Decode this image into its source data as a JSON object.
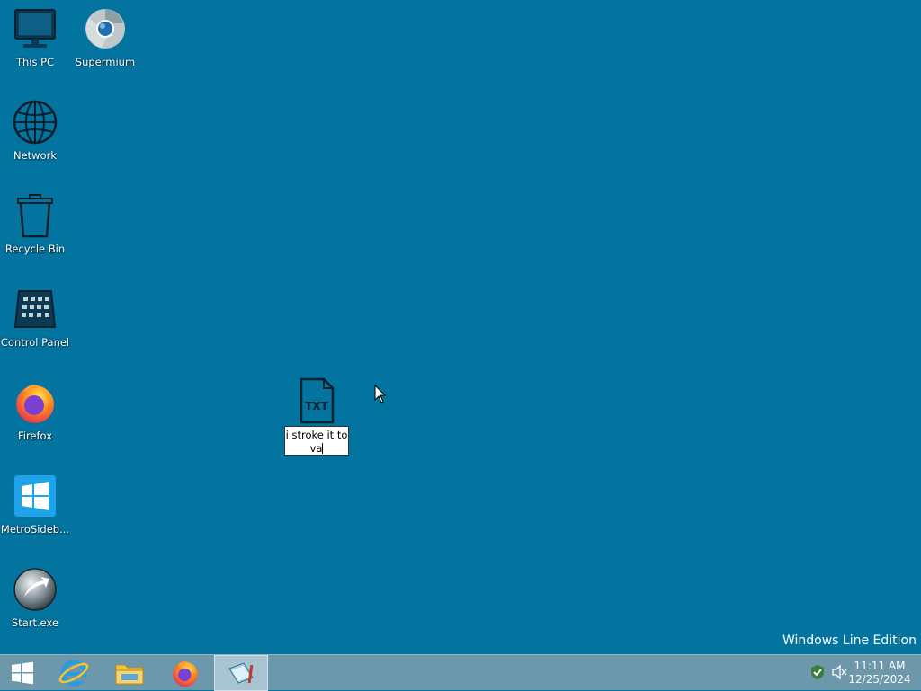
{
  "desktop": {
    "background_color": "#03739f",
    "icons": [
      {
        "label": "This PC",
        "icon": "monitor-icon"
      },
      {
        "label": "Supermium",
        "icon": "supermium-browser-icon"
      },
      {
        "label": "Network",
        "icon": "globe-icon"
      },
      {
        "label": "Recycle Bin",
        "icon": "trash-icon"
      },
      {
        "label": "Control Panel",
        "icon": "control-panel-icon"
      },
      {
        "label": "Firefox",
        "icon": "firefox-icon"
      },
      {
        "label": "MetroSideb...",
        "icon": "windows-tiles-icon"
      },
      {
        "label": "Start.exe",
        "icon": "start-orb-icon"
      }
    ],
    "renaming_file": {
      "icon": "txt-file-icon",
      "icon_text": "TXT",
      "name_input_value": "i stroke it to va"
    },
    "watermark": "Windows Line Edition"
  },
  "taskbar": {
    "buttons": [
      {
        "name": "start",
        "icon": "windows-logo-icon"
      },
      {
        "name": "internet-explorer",
        "icon": "ie-icon"
      },
      {
        "name": "file-explorer",
        "icon": "folder-icon"
      },
      {
        "name": "firefox",
        "icon": "firefox-icon"
      },
      {
        "name": "notepad",
        "icon": "notepad-icon",
        "active": true
      }
    ],
    "tray": {
      "icons": [
        "security-shield-icon",
        "volume-muted-icon"
      ],
      "time": "11:11 AM",
      "date": "12/25/2024"
    }
  }
}
